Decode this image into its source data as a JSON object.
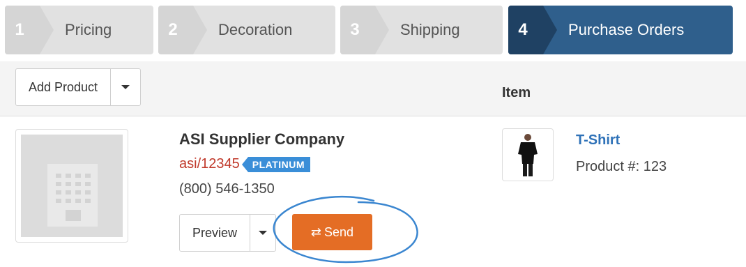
{
  "wizard": {
    "steps": [
      {
        "number": "1",
        "label": "Pricing",
        "state": "done"
      },
      {
        "number": "2",
        "label": "Decoration",
        "state": "done"
      },
      {
        "number": "3",
        "label": "Shipping",
        "state": "done"
      },
      {
        "number": "4",
        "label": "Purchase Orders",
        "state": "active"
      }
    ],
    "active_color": "#2f5f8c"
  },
  "toolbar": {
    "add_product_label": "Add Product"
  },
  "table": {
    "item_header": "Item"
  },
  "supplier": {
    "name": "ASI Supplier Company",
    "asi_number": "asi/12345",
    "badge": "PLATINUM",
    "phone": "(800) 546-1350",
    "logo_icon": "building-icon"
  },
  "actions": {
    "preview_label": "Preview",
    "send_label": "Send",
    "send_icon": "exchange-icon",
    "send_color": "#e46d25"
  },
  "item": {
    "name": "T-Shirt",
    "product_number": "Product #: 123",
    "thumb_icon": "tshirt-photo"
  }
}
